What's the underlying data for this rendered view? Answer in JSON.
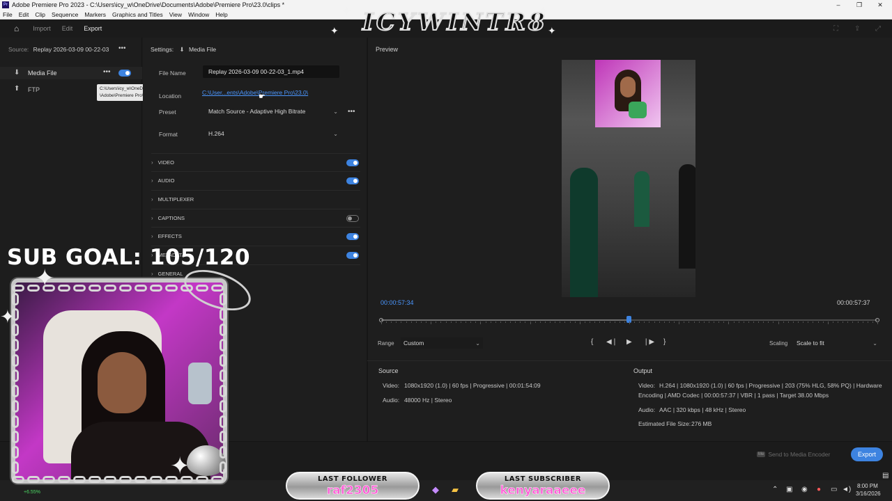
{
  "window": {
    "title": "Adobe Premiere Pro 2023 - C:\\Users\\icy_w\\OneDrive\\Documents\\Adobe\\Premiere Pro\\23.0\\clips *",
    "logo_text": "Pr"
  },
  "menubar": {
    "items": [
      "File",
      "Edit",
      "Clip",
      "Sequence",
      "Markers",
      "Graphics and Titles",
      "View",
      "Window",
      "Help"
    ]
  },
  "topnav": {
    "tabs": [
      "Import",
      "Edit",
      "Export"
    ],
    "active": "Export"
  },
  "overlay": {
    "watermark": "ICYWINTR8",
    "sub_goal": "SUB GOAL: 105/120",
    "last_follower_title": "LAST FOLLOWER",
    "last_follower": "raf2305",
    "last_subscriber_title": "LAST SUBSCRIBER",
    "last_subscriber": "kenyaraaeee"
  },
  "left": {
    "source_label": "Source:",
    "source_value": "Replay 2026-03-09 00-22-03",
    "destinations": [
      "Media File",
      "FTP"
    ],
    "tooltip_line1": "C:\\Users\\icy_w\\OneDrive\\Documents",
    "tooltip_line2": "\\Adobe\\Premiere Pro\\23.0\\"
  },
  "settings": {
    "header_label": "Settings:",
    "header_value": "Media File",
    "file_name_label": "File Name",
    "file_name": "Replay 2026-03-09 00-22-03_1.mp4",
    "location_label": "Location",
    "location": "C:\\User...ents\\Adobe\\Premiere Pro\\23.0\\",
    "preset_label": "Preset",
    "preset": "Match Source - Adaptive High Bitrate",
    "format_label": "Format",
    "format": "H.264",
    "sections": [
      "VIDEO",
      "AUDIO",
      "MULTIPLEXER",
      "CAPTIONS",
      "EFFECTS",
      "METADATA",
      "GENERAL"
    ],
    "section_toggles": [
      true,
      true,
      null,
      false,
      true,
      true,
      null
    ]
  },
  "preview": {
    "title": "Preview",
    "time_current": "00:00:57:34",
    "time_total": "00:00:57:37",
    "playhead_fraction": 0.498,
    "range_label": "Range",
    "range_value": "Custom",
    "scaling_label": "Scaling",
    "scaling_value": "Scale to fit"
  },
  "source_info": {
    "title": "Source",
    "video_label": "Video:",
    "video": "1080x1920 (1.0)  |  60 fps  |  Progressive  |  00:01:54:09",
    "audio_label": "Audio:",
    "audio": "48000 Hz  |  Stereo"
  },
  "output_info": {
    "title": "Output",
    "video_label": "Video:",
    "video_line1": "H.264  |  1080x1920 (1.0)  |  60 fps  |  Progressive  |  203 (75% HLG, 58% PQ)  |  Hardware",
    "video_line2": "Encoding  |  AMD Codec  |  00:00:57:37  |  VBR  |  1 pass  |  Target 38.00 Mbps",
    "audio_label": "Audio:",
    "audio": "AAC  |  320 kbps  |  48 kHz  |  Stereo",
    "size_label": "Estimated File Size:",
    "size": "276 MB"
  },
  "footer": {
    "send_label": "Send to Media Encoder",
    "export_label": "Export"
  },
  "taskbar": {
    "time": "8:00 PM",
    "date": "3/16/2026",
    "stock": "+6.55%"
  },
  "colors": {
    "accent": "#3d83e0",
    "panel": "#1e1e1e",
    "overlay_pink": "#ff5cd6"
  }
}
